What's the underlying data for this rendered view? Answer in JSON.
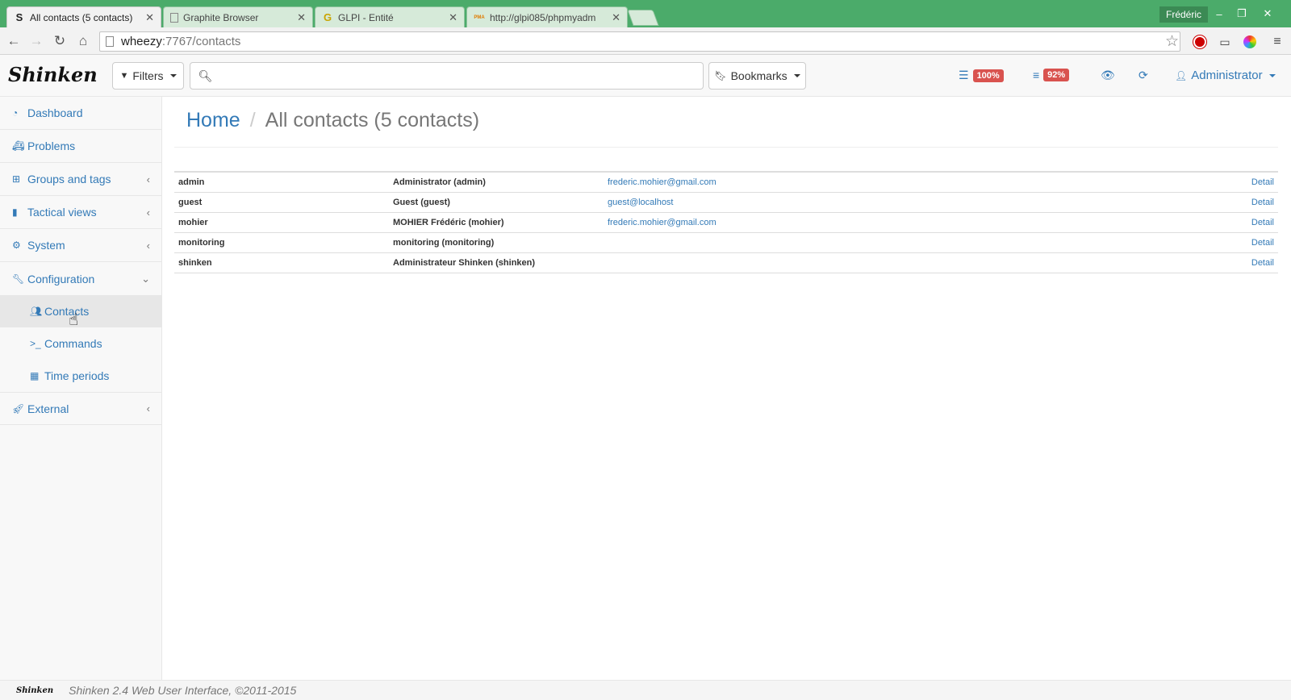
{
  "browser": {
    "tabs": [
      {
        "title": "All contacts (5 contacts)",
        "favicon": "S",
        "active": true
      },
      {
        "title": "Graphite Browser",
        "favicon": "",
        "active": false
      },
      {
        "title": "GLPI - Entité",
        "favicon": "G",
        "active": false
      },
      {
        "title": "http://glpi085/phpmyadm",
        "favicon": "PMA",
        "active": false
      }
    ],
    "profile_name": "Frédéric",
    "url_host": "wheezy",
    "url_path": ":7767/contacts",
    "colors": {
      "titlebar": "#4bab6a"
    }
  },
  "navbar": {
    "logo": "Shinken",
    "filters_label": "Filters",
    "bookmarks_label": "Bookmarks",
    "search_placeholder": "",
    "hosts_badge": "100%",
    "services_badge": "92%",
    "user_label": "Administrator"
  },
  "sidebar": {
    "items": [
      {
        "label": "Dashboard",
        "icon": "dashboard-icon"
      },
      {
        "label": "Problems",
        "icon": "ambulance-icon"
      },
      {
        "label": "Groups and tags",
        "icon": "sitemap-icon"
      },
      {
        "label": "Tactical views",
        "icon": "bar-chart-icon"
      },
      {
        "label": "System",
        "icon": "gears-icon"
      },
      {
        "label": "Configuration",
        "icon": "wrench-icon"
      },
      {
        "label": "External",
        "icon": "rocket-icon"
      }
    ],
    "sub_items": [
      {
        "label": "Contacts",
        "icon": "users-icon"
      },
      {
        "label": "Commands",
        "icon": "terminal-icon"
      },
      {
        "label": "Time periods",
        "icon": "calendar-icon"
      }
    ]
  },
  "main": {
    "breadcrumb_home": "Home",
    "breadcrumb_current": "All contacts (5 contacts)",
    "contacts": [
      {
        "name": "admin",
        "alias": "Administrator (admin)",
        "email": "frederic.mohier@gmail.com",
        "action": "Detail"
      },
      {
        "name": "guest",
        "alias": "Guest (guest)",
        "email": "guest@localhost",
        "action": "Detail"
      },
      {
        "name": "mohier",
        "alias": "MOHIER Frédéric (mohier)",
        "email": "frederic.mohier@gmail.com",
        "action": "Detail"
      },
      {
        "name": "monitoring",
        "alias": "monitoring (monitoring)",
        "email": "",
        "action": "Detail"
      },
      {
        "name": "shinken",
        "alias": "Administrateur Shinken (shinken)",
        "email": "",
        "action": "Detail"
      }
    ]
  },
  "footer": {
    "logo": "Shinken",
    "text": "Shinken 2.4 Web User Interface, ©2011-2015"
  }
}
